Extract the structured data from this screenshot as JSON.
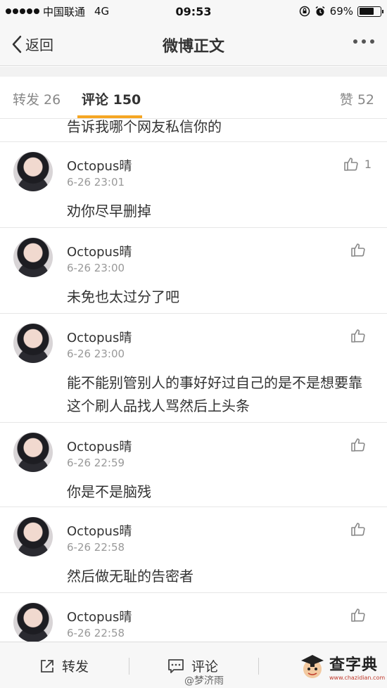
{
  "status": {
    "carrier": "中国联通",
    "network": "4G",
    "time": "09:53",
    "battery": "69%",
    "battery_level": 0.69
  },
  "nav": {
    "back_label": "返回",
    "title": "微博正文"
  },
  "tabs": {
    "repost": "转发 26",
    "comments": "评论 150",
    "likes": "赞 52"
  },
  "partial_comment_text": "告诉我哪个网友私信你的",
  "comments": [
    {
      "user": "Octopus晴",
      "time": "6-26 23:01",
      "text": "劝你尽早删掉",
      "likes": "1"
    },
    {
      "user": "Octopus晴",
      "time": "6-26 23:00",
      "text": "未免也太过分了吧",
      "likes": ""
    },
    {
      "user": "Octopus晴",
      "time": "6-26 23:00",
      "text": "能不能别管别人的事好好过自己的是不是想要靠这个刷人品找人骂然后上头条",
      "likes": ""
    },
    {
      "user": "Octopus晴",
      "time": "6-26 22:59",
      "text": "你是不是脑残",
      "likes": ""
    },
    {
      "user": "Octopus晴",
      "time": "6-26 22:58",
      "text": "然后做无耻的告密者",
      "likes": ""
    },
    {
      "user": "Octopus晴",
      "time": "6-26 22:58",
      "text": "",
      "likes": ""
    }
  ],
  "toolbar": {
    "repost_label": "转发",
    "comment_label": "评论",
    "watermark_user": "@梦济雨"
  },
  "logo": {
    "title": "查字典",
    "url": "www.chazidian.com"
  },
  "colors": {
    "accent": "#f5a623",
    "bar_bg": "#f7f7f7",
    "muted": "#999999"
  }
}
